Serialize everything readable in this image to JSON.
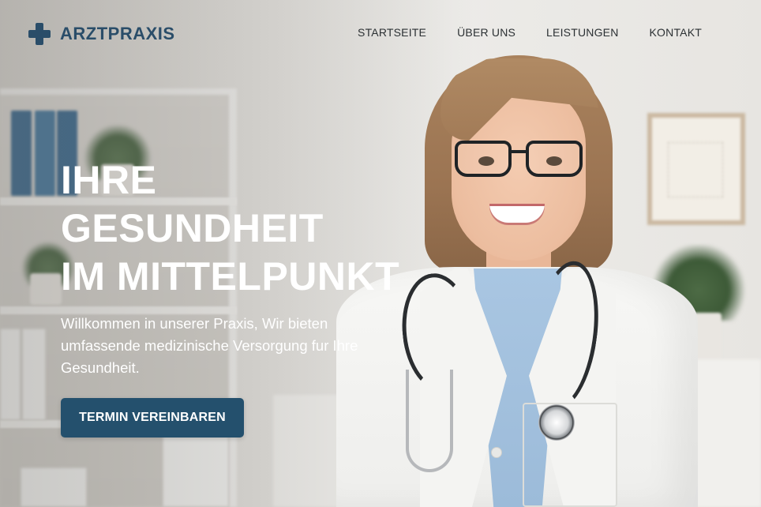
{
  "brand": {
    "name": "ARZTPRAXIS",
    "icon": "medical-cross-icon",
    "color": "#2a4d69"
  },
  "nav": {
    "items": [
      {
        "label": "STARTSEITE"
      },
      {
        "label": "ÜBER UNS"
      },
      {
        "label": "LEISTUNGEN"
      },
      {
        "label": "KONTAKT"
      }
    ]
  },
  "hero": {
    "headline_lines": [
      "IHRE",
      "GESUNDHEIT",
      "IM MITTELPUNKT"
    ],
    "subtext": "Willkommen in unserer Praxis, Wir bieten umfassende medizinische Versorgung fur Ihre Gesundheit.",
    "cta_label": "TERMIN VEREINBAREN",
    "cta_color": "#24506d"
  }
}
